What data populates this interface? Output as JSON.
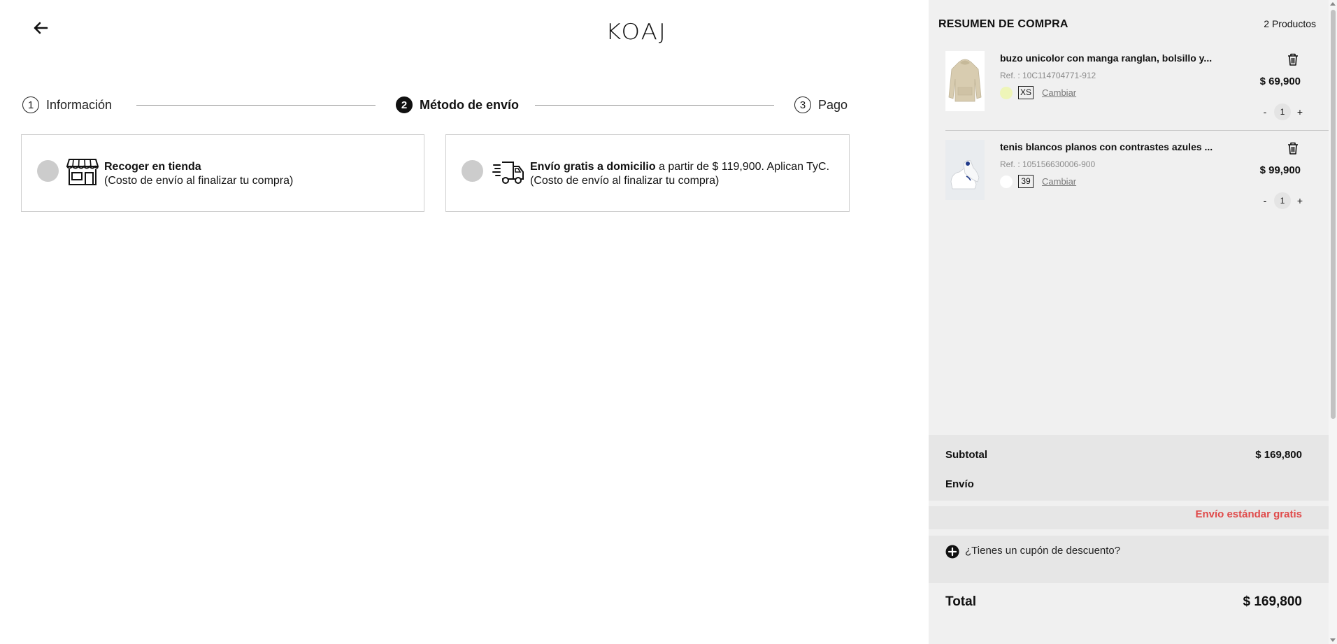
{
  "header": {
    "logo": "KOAJ",
    "back_icon": "arrow-left-icon"
  },
  "steps": [
    {
      "number": "1",
      "label": "Información",
      "active": false
    },
    {
      "number": "2",
      "label": "Método de envío",
      "active": true
    },
    {
      "number": "3",
      "label": "Pago",
      "active": false
    }
  ],
  "shipping_options": [
    {
      "icon": "store-icon",
      "title": "Recoger en tienda",
      "rest": "",
      "note": "(Costo de envío al finalizar tu compra)"
    },
    {
      "icon": "delivery-truck-icon",
      "title": "Envío gratis a domicilio",
      "rest": " a partir de $ 119,900. Aplican TyC.",
      "note": "(Costo de envío al finalizar tu compra)"
    }
  ],
  "summary": {
    "title": "RESUMEN DE COMPRA",
    "count": "2 Productos",
    "products": [
      {
        "name": "buzo unicolor con manga ranglan, bolsillo y...",
        "ref": "Ref. : 10C114704771-912",
        "swatch_color": "#eef5b8",
        "size": "XS",
        "change": "Cambiar",
        "price": "$ 69,900",
        "qty": "1",
        "minus": "-",
        "plus": "+"
      },
      {
        "name": "tenis blancos planos con contrastes azules ...",
        "ref": "Ref. : 105156630006-900",
        "swatch_color": "#ffffff",
        "size": "39",
        "change": "Cambiar",
        "price": "$ 99,900",
        "qty": "1",
        "minus": "-",
        "plus": "+"
      }
    ],
    "subtotal_label": "Subtotal",
    "subtotal_value": "$ 169,800",
    "shipping_label": "Envío",
    "shipping_free": "Envío estándar gratis",
    "coupon": "¿Tienes un cupón de descuento?",
    "total_label": "Total",
    "total_value": "$ 169,800"
  },
  "colors": {
    "accent_red": "#e04a4a",
    "sidebar_bg": "#f0f0f0",
    "radio_gray": "#cccccc"
  }
}
